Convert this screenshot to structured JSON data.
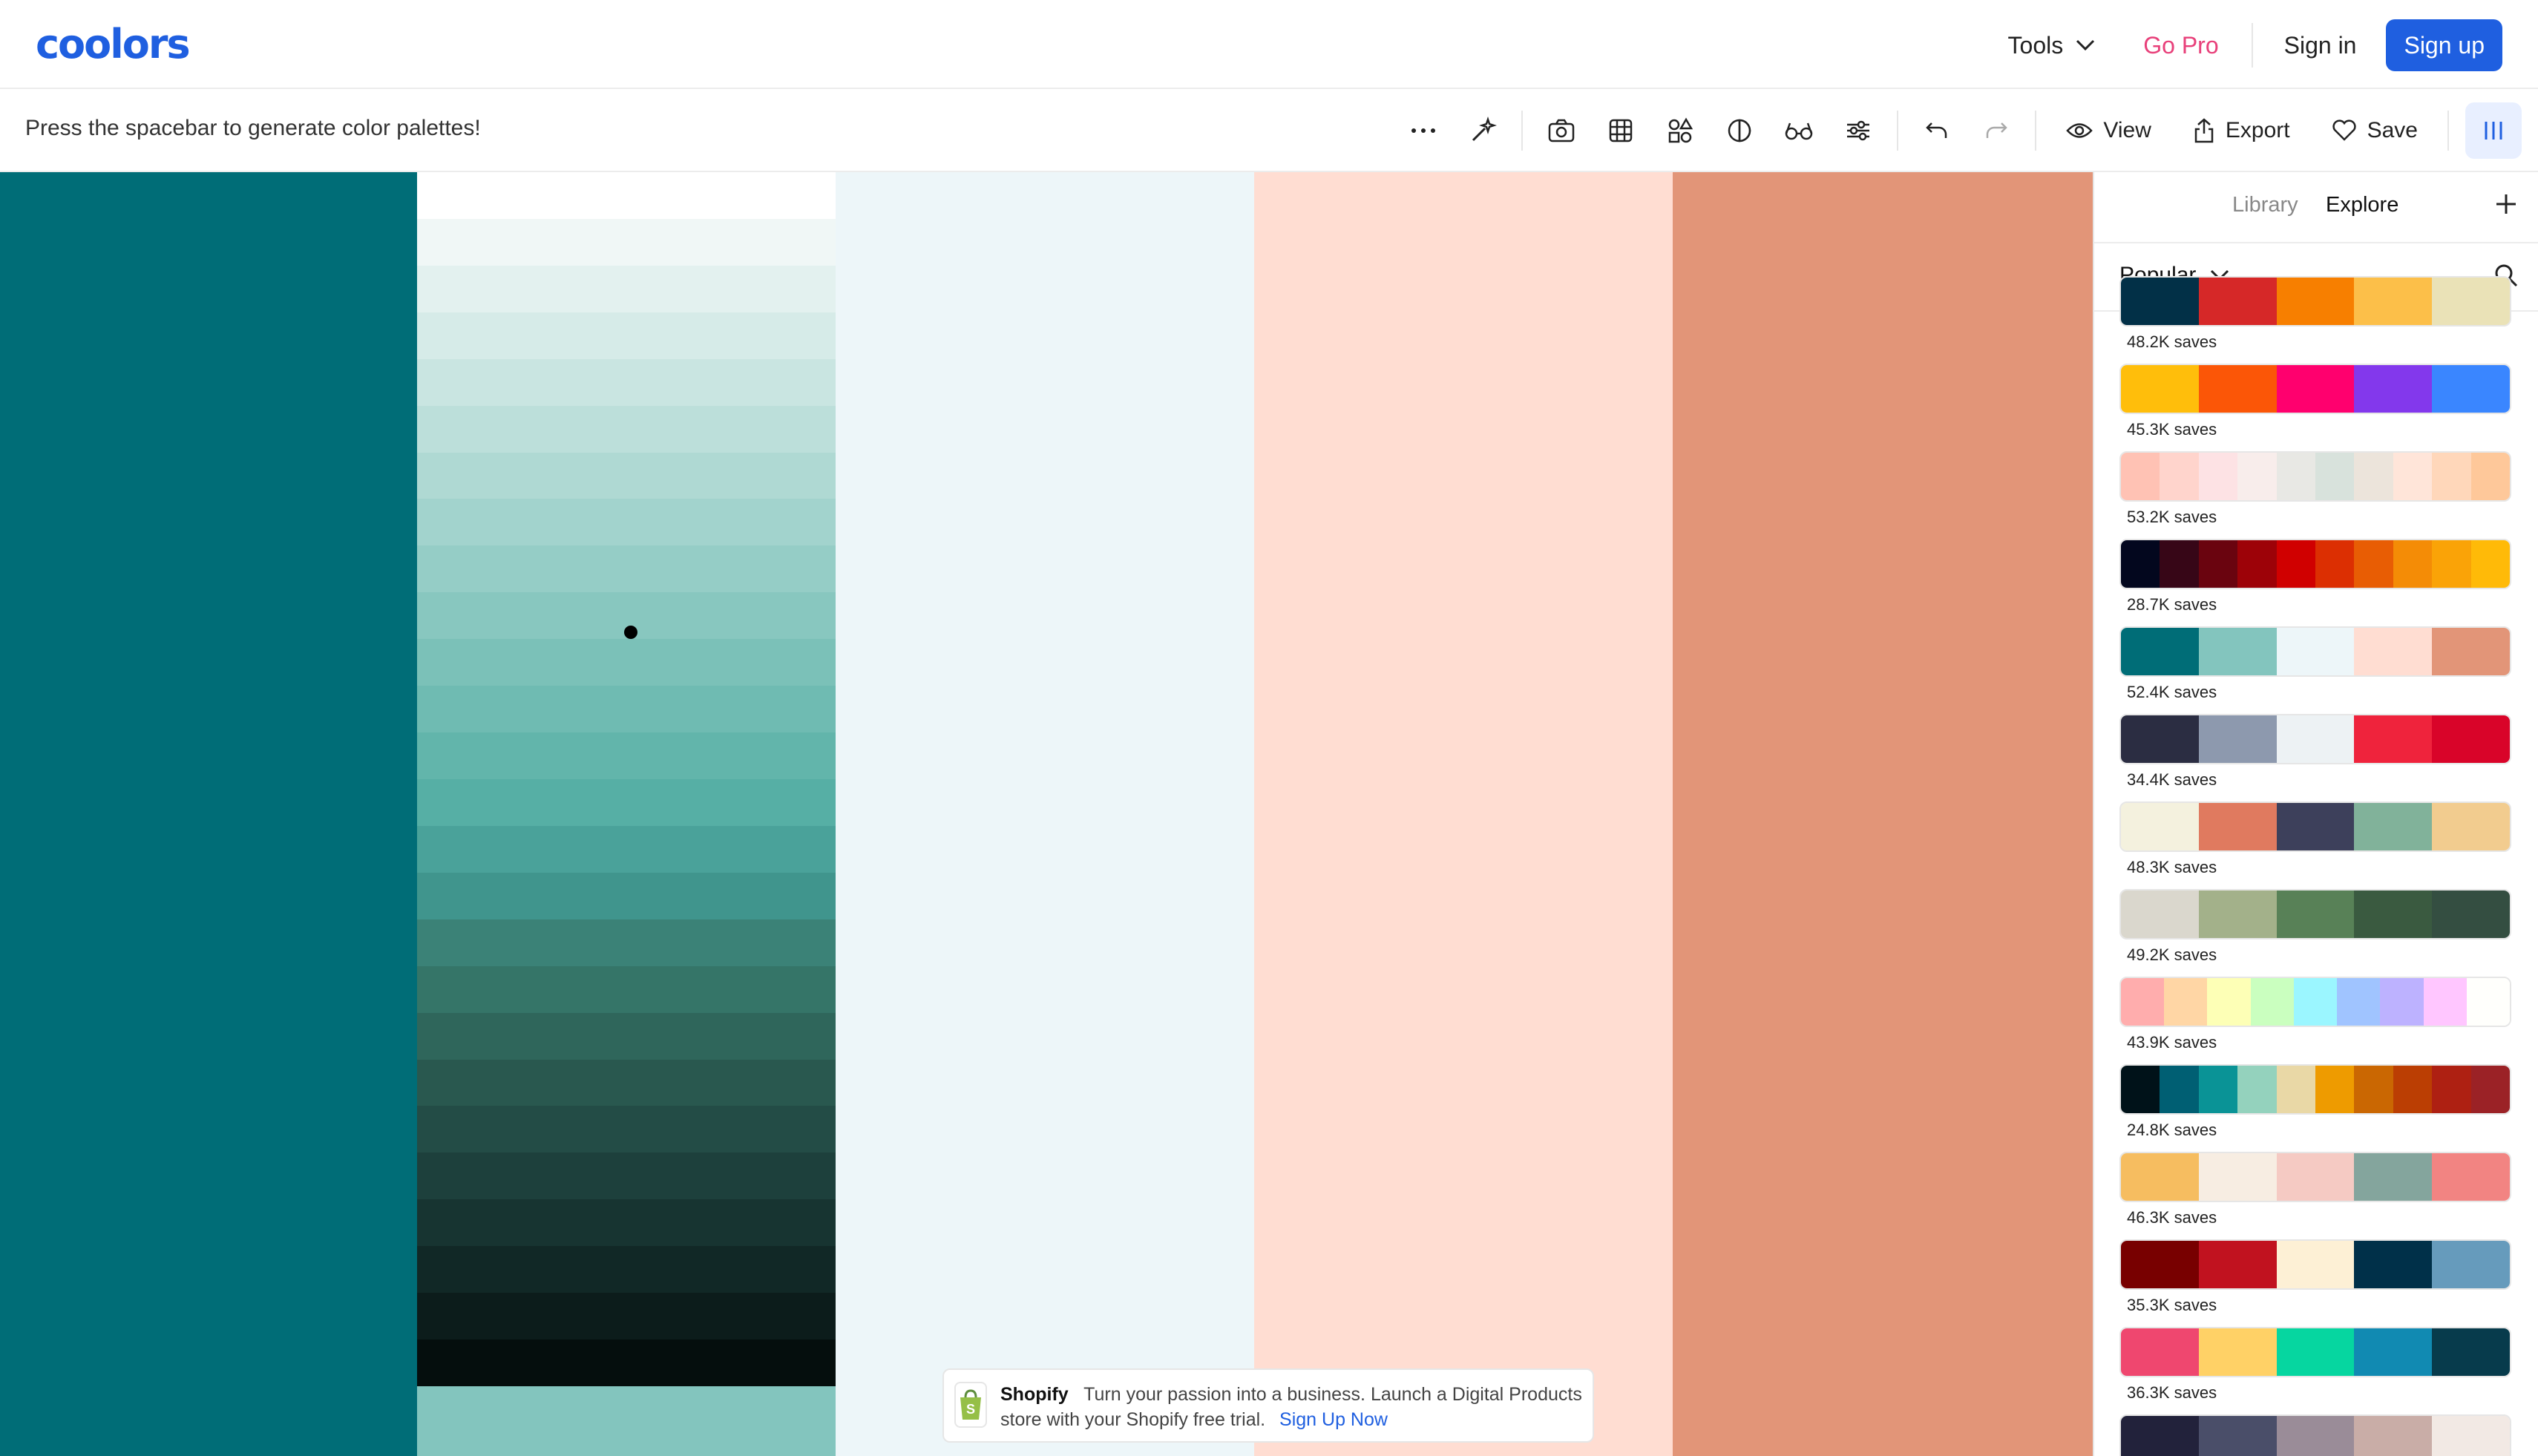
{
  "nav": {
    "logo": "coolors",
    "tools_label": "Tools",
    "gopro_label": "Go Pro",
    "signin_label": "Sign in",
    "signup_label": "Sign up"
  },
  "toolbar": {
    "hint": "Press the spacebar to generate color palettes!",
    "view_label": "View",
    "export_label": "Export",
    "save_label": "Save"
  },
  "columns": [
    {
      "color": "#006d77"
    },
    {
      "color": "#ffffff",
      "base": "#83c5be",
      "shades": [
        "#ffffff",
        "#f0f7f6",
        "#e3f1ef",
        "#d6ebe8",
        "#c9e5e1",
        "#bcdfda",
        "#afd9d3",
        "#a2d3cd",
        "#95cdc6",
        "#88c7bf",
        "#7bc1b8",
        "#6fbbb2",
        "#62b5ab",
        "#56afa5",
        "#4aa29a",
        "#40958d",
        "#3b8277",
        "#357568",
        "#2f665b",
        "#29584f",
        "#234c46",
        "#1d403c",
        "#173431",
        "#112826",
        "#0c1c1b",
        "#050e0d"
      ]
    },
    {
      "color": "#edf6f9"
    },
    {
      "color": "#ffddd2"
    },
    {
      "color": "#e29578"
    }
  ],
  "ad": {
    "brand": "Shopify",
    "text": "Turn your passion into a business. Launch a Digital Products store with your Shopify free trial.",
    "cta": "Sign Up Now"
  },
  "sidebar": {
    "tab_library": "Library",
    "tab_explore": "Explore",
    "filter_label": "Popular",
    "palettes": [
      {
        "colors": [
          "#023047",
          "#d62828",
          "#f77f00",
          "#fcbf49",
          "#eae2b7"
        ],
        "saves": "48.2K saves"
      },
      {
        "colors": [
          "#ffbe0b",
          "#fb5607",
          "#ff006e",
          "#8338ec",
          "#3a86ff"
        ],
        "saves": "45.3K saves"
      },
      {
        "colors": [
          "#ffc2b4",
          "#ffd4cc",
          "#fde2e4",
          "#f8edeb",
          "#e8e8e4",
          "#d8e2dc",
          "#ece4db",
          "#ffe5d9",
          "#ffd7ba",
          "#fec89a"
        ],
        "saves": "53.2K saves"
      },
      {
        "colors": [
          "#03071e",
          "#370617",
          "#6a040f",
          "#9d0208",
          "#d00000",
          "#dc2f02",
          "#e85d04",
          "#f48c06",
          "#faa307",
          "#ffba08"
        ],
        "saves": "28.7K saves"
      },
      {
        "colors": [
          "#006d77",
          "#83c5be",
          "#edf6f9",
          "#ffddd2",
          "#e29578"
        ],
        "saves": "52.4K saves"
      },
      {
        "colors": [
          "#2b2d42",
          "#8d99ae",
          "#edf2f4",
          "#ef233c",
          "#d90429"
        ],
        "saves": "34.4K saves"
      },
      {
        "colors": [
          "#f4f1de",
          "#e07a5f",
          "#3d405b",
          "#81b29a",
          "#f2cc8f"
        ],
        "saves": "48.3K saves"
      },
      {
        "colors": [
          "#dad7cd",
          "#a3b18a",
          "#588157",
          "#3a5a40",
          "#344e41"
        ],
        "saves": "49.2K saves"
      },
      {
        "colors": [
          "#ffadad",
          "#ffd6a5",
          "#fdffb6",
          "#caffbf",
          "#9bf6ff",
          "#a0c4ff",
          "#bdb2ff",
          "#ffc6ff",
          "#fffffc"
        ],
        "saves": "43.9K saves"
      },
      {
        "colors": [
          "#001219",
          "#005f73",
          "#0a9396",
          "#94d2bd",
          "#e9d8a6",
          "#ee9b00",
          "#ca6702",
          "#bb3e03",
          "#ae2012",
          "#9b2226"
        ],
        "saves": "24.8K saves"
      },
      {
        "colors": [
          "#f6bd60",
          "#f7ede2",
          "#f5cac3",
          "#84a59d",
          "#f28482"
        ],
        "saves": "46.3K saves"
      },
      {
        "colors": [
          "#780000",
          "#c1121f",
          "#fdf0d5",
          "#003049",
          "#669bbc"
        ],
        "saves": "35.3K saves"
      },
      {
        "colors": [
          "#ef476f",
          "#ffd166",
          "#06d6a0",
          "#118ab2",
          "#073b4c"
        ],
        "saves": "36.3K saves"
      },
      {
        "colors": [
          "#22223b",
          "#4a4e69",
          "#9a8c98",
          "#c9ada7",
          "#f2e9e4"
        ],
        "saves": ""
      }
    ]
  }
}
